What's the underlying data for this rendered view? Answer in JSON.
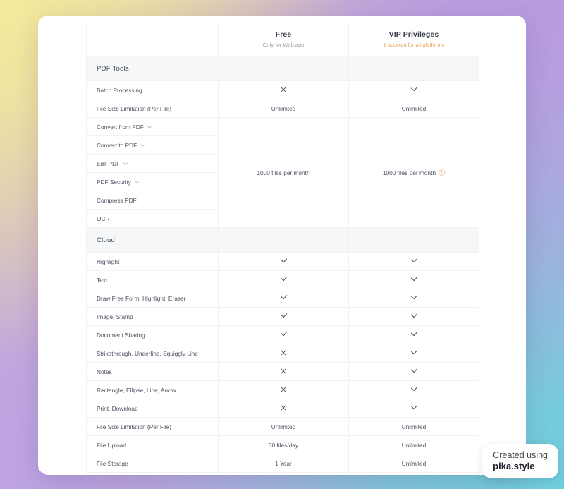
{
  "background": {
    "top_left": "#f4e99b",
    "top_right": "#b79ae0",
    "bottom_left": "#bda3e2",
    "bottom_right": "#6ecddc"
  },
  "accents": {
    "vip_subtitle": "#e8a361",
    "info_icon": "#e8a361",
    "section_bg": "#f6f7f9",
    "text": "#4d5261"
  },
  "table": {
    "columns": [
      {
        "key": "feature",
        "label": ""
      },
      {
        "key": "free",
        "label": "Free",
        "sublabel": "Only for Web app"
      },
      {
        "key": "vip",
        "label": "VIP Privileges",
        "sublabel": "1 account for all platforms"
      }
    ],
    "sections": [
      {
        "title": "PDF Tools",
        "rows": [
          {
            "feature": "Batch Processing",
            "chevron": false,
            "free": "cross",
            "vip": "check"
          },
          {
            "feature": "File Size Limitation (Per File)",
            "chevron": false,
            "free": "Unlimited",
            "vip": "Unlimited"
          },
          {
            "feature": "Convert from PDF",
            "chevron": true,
            "merged": true
          },
          {
            "feature": "Convert to PDF",
            "chevron": true,
            "merged": true
          },
          {
            "feature": "Edit PDF",
            "chevron": true,
            "merged": true
          },
          {
            "feature": "PDF Security",
            "chevron": true,
            "merged": true
          },
          {
            "feature": "Compress PDF",
            "chevron": false,
            "merged": true
          },
          {
            "feature": "OCR",
            "chevron": false,
            "merged": true
          }
        ],
        "merged_free": "1000 files per month",
        "merged_vip": "1000 files per month",
        "merged_vip_info": true
      },
      {
        "title": "Cloud",
        "rows": [
          {
            "feature": "Highlight",
            "chevron": false,
            "free": "check",
            "vip": "check"
          },
          {
            "feature": "Text",
            "chevron": false,
            "free": "check",
            "vip": "check"
          },
          {
            "feature": "Draw Free Form, Highlight, Eraser",
            "chevron": false,
            "free": "check",
            "vip": "check"
          },
          {
            "feature": "Image, Stamp",
            "chevron": false,
            "free": "check",
            "vip": "check"
          },
          {
            "feature": "Document Sharing",
            "chevron": false,
            "free": "check",
            "vip": "check"
          },
          {
            "feature": "Strikethrough, Underline, Squiggly Line",
            "chevron": false,
            "free": "cross",
            "vip": "check"
          },
          {
            "feature": "Notes",
            "chevron": false,
            "free": "cross",
            "vip": "check"
          },
          {
            "feature": "Rectangle, Ellipse, Line, Arrow",
            "chevron": false,
            "free": "cross",
            "vip": "check"
          },
          {
            "feature": "Print, Download",
            "chevron": false,
            "free": "cross",
            "vip": "check"
          },
          {
            "feature": "File Size Limitation (Per File)",
            "chevron": false,
            "free": "Unlimited",
            "vip": "Unlimited"
          },
          {
            "feature": "File Upload",
            "chevron": false,
            "free": "30 files/day",
            "vip": "Unlimited"
          },
          {
            "feature": "File Storage",
            "chevron": false,
            "free": "1 Year",
            "vip": "Unlimited"
          }
        ]
      }
    ]
  },
  "watermark": {
    "line1": "Created using",
    "line2": "pika.style"
  }
}
